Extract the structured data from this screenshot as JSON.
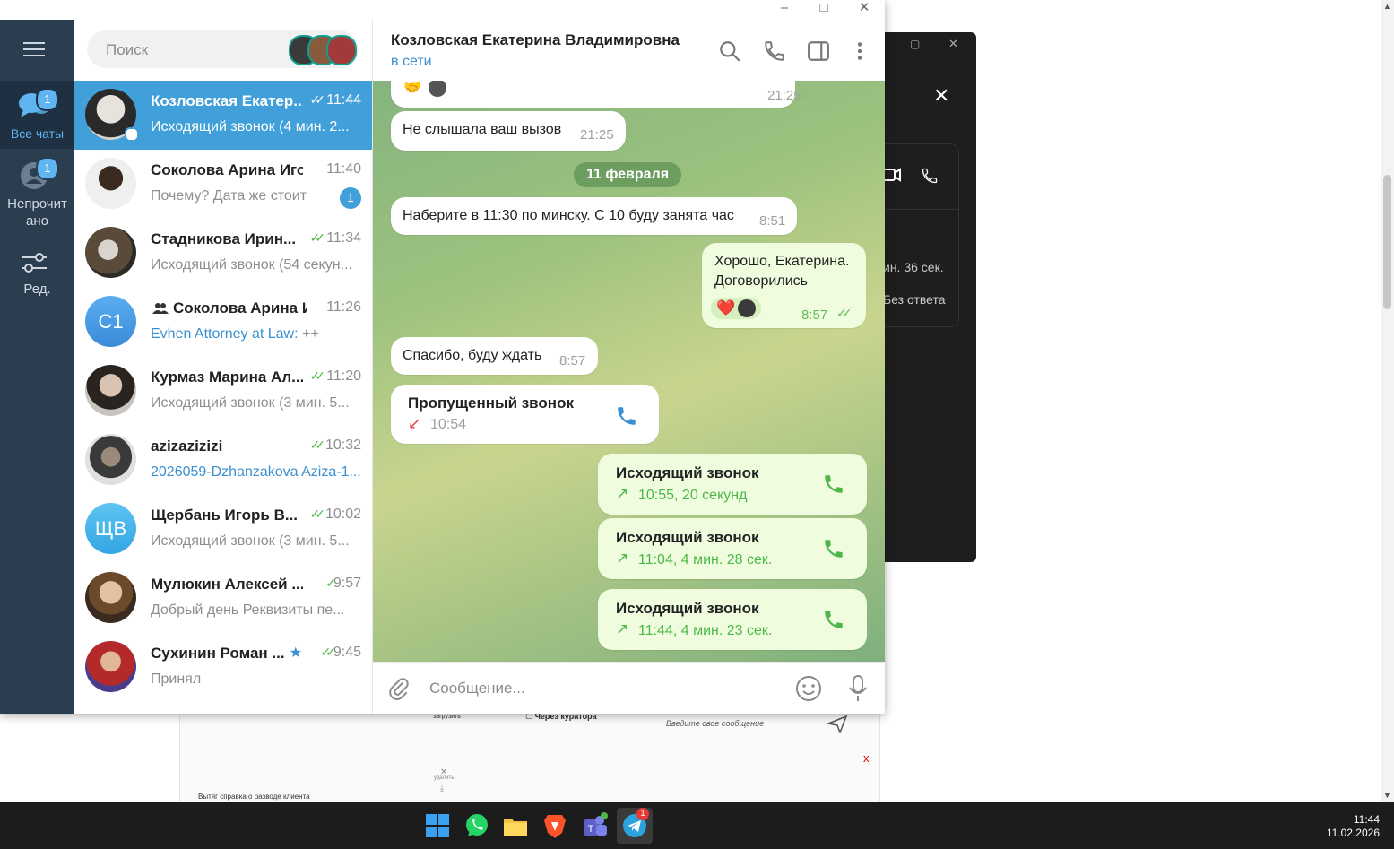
{
  "window": {
    "minimize": "–",
    "maximize": "□",
    "close": "✕"
  },
  "rail": {
    "all_chats": {
      "label": "Все чаты",
      "badge": "1"
    },
    "unread": {
      "label": "Непрочит\nано",
      "badge": "1"
    },
    "edit": {
      "label": "Ред."
    }
  },
  "search": {
    "placeholder": "Поиск"
  },
  "chats": [
    {
      "name": "Козловская Екатер...",
      "time": "11:44",
      "preview": "Исходящий звонок (4 мин. 2...",
      "ticks": "✓✓"
    },
    {
      "name": "Соколова Арина Игор...",
      "time": "11:40",
      "preview": "Почему? Дата же стоит",
      "badge": "1"
    },
    {
      "name": "Стадникова Ирин...",
      "time": "11:34",
      "preview": "Исходящий звонок (54 секун...",
      "ticks": "✓✓"
    },
    {
      "name": "Соколова Арина И...",
      "time": "11:26",
      "preview_sender": "Evhen Attorney at Law:",
      "preview": " ++",
      "initials": "С1"
    },
    {
      "name": "Курмаз Марина Ал...",
      "time": "11:20",
      "preview": "Исходящий звонок (3 мин. 5...",
      "ticks": "✓✓"
    },
    {
      "name": "azizazizizi",
      "time": "10:32",
      "preview": "2026059-Dzhanzakova Aziza-1...",
      "ticks": "✓✓"
    },
    {
      "name": "Щербань Игорь В...",
      "time": "10:02",
      "preview": "Исходящий звонок (3 мин. 5...",
      "ticks": "✓✓",
      "initials": "ЩВ"
    },
    {
      "name": "Мулюкин Алексей ...",
      "time": "9:57",
      "preview": "Добрый день Реквизиты пе...",
      "ticks": "✓"
    },
    {
      "name": "Сухинин Роман ...",
      "time": "9:45",
      "preview": "Принял",
      "ticks": "✓✓"
    }
  ],
  "header": {
    "name": "Козловская Екатерина Владимировна",
    "status": "в сети"
  },
  "messages": {
    "m0_time": "21:25",
    "m1": {
      "text": "Не слышала ваш вызов",
      "time": "21:25"
    },
    "date": "11 февраля",
    "m2": {
      "text": "Наберите в 11:30 по минску. С 10 буду занята час",
      "time": "8:51"
    },
    "m3": {
      "text1": "Хорошо, Екатерина.",
      "text2": "Договорились",
      "time": "8:57",
      "reaction": "❤️"
    },
    "m4": {
      "text": "Спасибо, буду ждать",
      "time": "8:57"
    },
    "missed": {
      "title": "Пропущенный звонок",
      "time": "10:54"
    },
    "out1": {
      "title": "Исходящий звонок",
      "sub": "10:55, 20 секунд"
    },
    "out2": {
      "title": "Исходящий звонок",
      "sub": "11:04, 4 мин. 28 сек."
    },
    "out3": {
      "title": "Исходящий звонок",
      "sub": "11:44, 4 мин. 23 сек."
    }
  },
  "composer": {
    "placeholder": "Сообщение..."
  },
  "background_page": {
    "upload": "загрузить",
    "curator": "Через куратора",
    "msg_placeholder": "Введите свое сообщение",
    "delete": "удалить",
    "download": "скачать",
    "divorce": "Вытяг справка о разводе клиента",
    "x": "x"
  },
  "call_window": {
    "text1": "ин. 36 сек.",
    "text2": "Без ответа"
  },
  "taskbar": {
    "time": "11:44",
    "date": "11.02.2026",
    "telegram_badge": "1"
  },
  "colors": {
    "accent": "#419fd9",
    "rail": "#2b3e50",
    "outgoing": "#effdde",
    "green": "#4db848"
  }
}
